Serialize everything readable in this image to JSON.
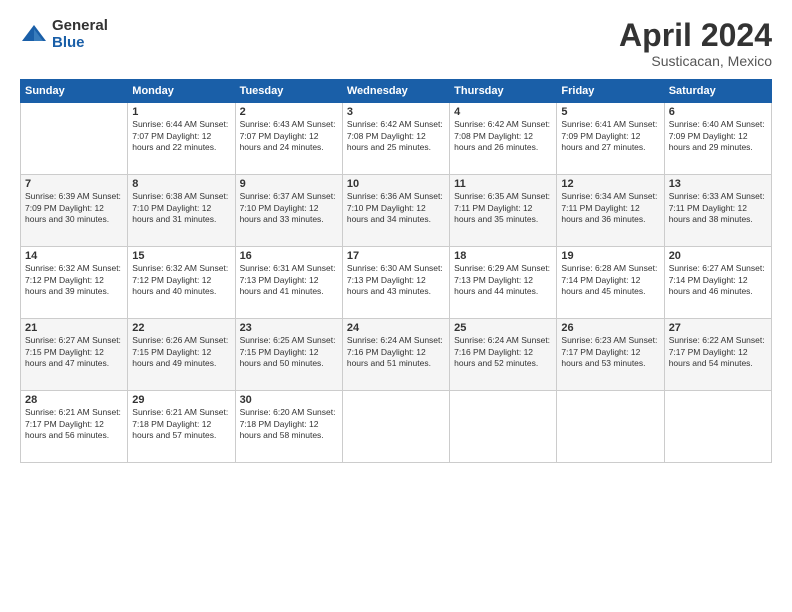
{
  "logo": {
    "general": "General",
    "blue": "Blue"
  },
  "title": "April 2024",
  "subtitle": "Susticacan, Mexico",
  "headers": [
    "Sunday",
    "Monday",
    "Tuesday",
    "Wednesday",
    "Thursday",
    "Friday",
    "Saturday"
  ],
  "weeks": [
    [
      {
        "num": "",
        "info": ""
      },
      {
        "num": "1",
        "info": "Sunrise: 6:44 AM\nSunset: 7:07 PM\nDaylight: 12 hours\nand 22 minutes."
      },
      {
        "num": "2",
        "info": "Sunrise: 6:43 AM\nSunset: 7:07 PM\nDaylight: 12 hours\nand 24 minutes."
      },
      {
        "num": "3",
        "info": "Sunrise: 6:42 AM\nSunset: 7:08 PM\nDaylight: 12 hours\nand 25 minutes."
      },
      {
        "num": "4",
        "info": "Sunrise: 6:42 AM\nSunset: 7:08 PM\nDaylight: 12 hours\nand 26 minutes."
      },
      {
        "num": "5",
        "info": "Sunrise: 6:41 AM\nSunset: 7:09 PM\nDaylight: 12 hours\nand 27 minutes."
      },
      {
        "num": "6",
        "info": "Sunrise: 6:40 AM\nSunset: 7:09 PM\nDaylight: 12 hours\nand 29 minutes."
      }
    ],
    [
      {
        "num": "7",
        "info": "Sunrise: 6:39 AM\nSunset: 7:09 PM\nDaylight: 12 hours\nand 30 minutes."
      },
      {
        "num": "8",
        "info": "Sunrise: 6:38 AM\nSunset: 7:10 PM\nDaylight: 12 hours\nand 31 minutes."
      },
      {
        "num": "9",
        "info": "Sunrise: 6:37 AM\nSunset: 7:10 PM\nDaylight: 12 hours\nand 33 minutes."
      },
      {
        "num": "10",
        "info": "Sunrise: 6:36 AM\nSunset: 7:10 PM\nDaylight: 12 hours\nand 34 minutes."
      },
      {
        "num": "11",
        "info": "Sunrise: 6:35 AM\nSunset: 7:11 PM\nDaylight: 12 hours\nand 35 minutes."
      },
      {
        "num": "12",
        "info": "Sunrise: 6:34 AM\nSunset: 7:11 PM\nDaylight: 12 hours\nand 36 minutes."
      },
      {
        "num": "13",
        "info": "Sunrise: 6:33 AM\nSunset: 7:11 PM\nDaylight: 12 hours\nand 38 minutes."
      }
    ],
    [
      {
        "num": "14",
        "info": "Sunrise: 6:32 AM\nSunset: 7:12 PM\nDaylight: 12 hours\nand 39 minutes."
      },
      {
        "num": "15",
        "info": "Sunrise: 6:32 AM\nSunset: 7:12 PM\nDaylight: 12 hours\nand 40 minutes."
      },
      {
        "num": "16",
        "info": "Sunrise: 6:31 AM\nSunset: 7:13 PM\nDaylight: 12 hours\nand 41 minutes."
      },
      {
        "num": "17",
        "info": "Sunrise: 6:30 AM\nSunset: 7:13 PM\nDaylight: 12 hours\nand 43 minutes."
      },
      {
        "num": "18",
        "info": "Sunrise: 6:29 AM\nSunset: 7:13 PM\nDaylight: 12 hours\nand 44 minutes."
      },
      {
        "num": "19",
        "info": "Sunrise: 6:28 AM\nSunset: 7:14 PM\nDaylight: 12 hours\nand 45 minutes."
      },
      {
        "num": "20",
        "info": "Sunrise: 6:27 AM\nSunset: 7:14 PM\nDaylight: 12 hours\nand 46 minutes."
      }
    ],
    [
      {
        "num": "21",
        "info": "Sunrise: 6:27 AM\nSunset: 7:15 PM\nDaylight: 12 hours\nand 47 minutes."
      },
      {
        "num": "22",
        "info": "Sunrise: 6:26 AM\nSunset: 7:15 PM\nDaylight: 12 hours\nand 49 minutes."
      },
      {
        "num": "23",
        "info": "Sunrise: 6:25 AM\nSunset: 7:15 PM\nDaylight: 12 hours\nand 50 minutes."
      },
      {
        "num": "24",
        "info": "Sunrise: 6:24 AM\nSunset: 7:16 PM\nDaylight: 12 hours\nand 51 minutes."
      },
      {
        "num": "25",
        "info": "Sunrise: 6:24 AM\nSunset: 7:16 PM\nDaylight: 12 hours\nand 52 minutes."
      },
      {
        "num": "26",
        "info": "Sunrise: 6:23 AM\nSunset: 7:17 PM\nDaylight: 12 hours\nand 53 minutes."
      },
      {
        "num": "27",
        "info": "Sunrise: 6:22 AM\nSunset: 7:17 PM\nDaylight: 12 hours\nand 54 minutes."
      }
    ],
    [
      {
        "num": "28",
        "info": "Sunrise: 6:21 AM\nSunset: 7:17 PM\nDaylight: 12 hours\nand 56 minutes."
      },
      {
        "num": "29",
        "info": "Sunrise: 6:21 AM\nSunset: 7:18 PM\nDaylight: 12 hours\nand 57 minutes."
      },
      {
        "num": "30",
        "info": "Sunrise: 6:20 AM\nSunset: 7:18 PM\nDaylight: 12 hours\nand 58 minutes."
      },
      {
        "num": "",
        "info": ""
      },
      {
        "num": "",
        "info": ""
      },
      {
        "num": "",
        "info": ""
      },
      {
        "num": "",
        "info": ""
      }
    ]
  ]
}
